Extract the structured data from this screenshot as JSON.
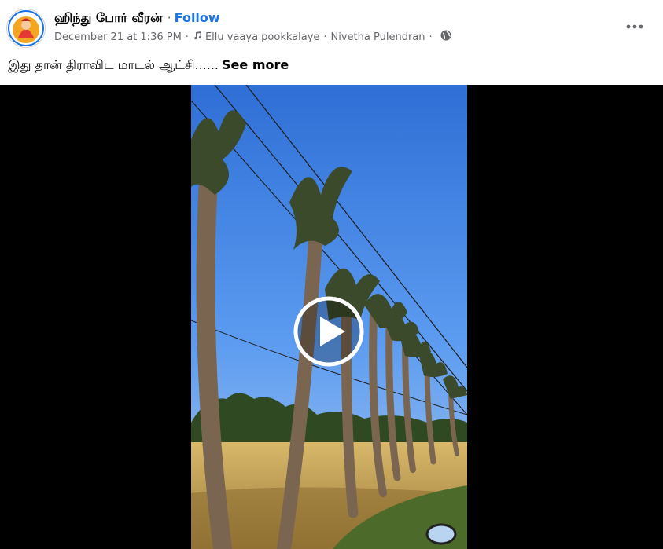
{
  "post": {
    "author": "ஹிந்து போர் வீரன்",
    "separator": "·",
    "follow_label": "Follow",
    "timestamp": "December 21 at 1:36 PM",
    "music": "Ellu vaaya pookkalaye",
    "music_artist": "Nivetha Pulendran",
    "audience_icon": "globe-icon",
    "more_icon": "more-horizontal-icon",
    "caption": "இது தான் திராவிட மாடல் ஆட்சி......",
    "see_more_label": "See more"
  },
  "video": {
    "play_icon": "play-icon",
    "colors": {
      "sky": "#3f86e6",
      "field": "#c9a85a",
      "letterbox": "#000000"
    }
  }
}
